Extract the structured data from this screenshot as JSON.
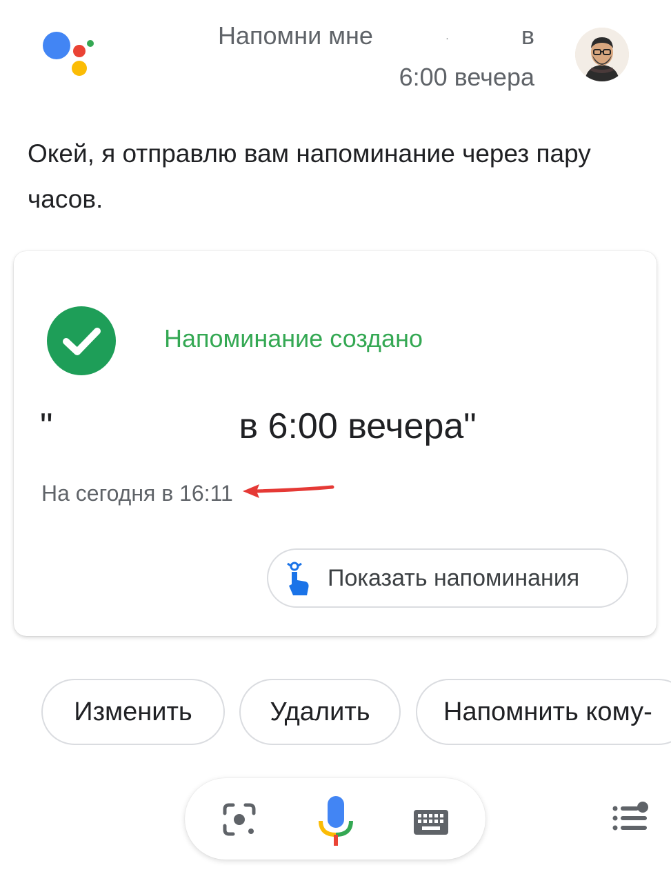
{
  "query": {
    "line1_start": "Напомни мне",
    "line1_dot": ".",
    "line1_end": "в",
    "line2": "6:00 вечера"
  },
  "reply": {
    "text": "Окей, я отправлю вам напоминание через пару часов."
  },
  "card": {
    "status": "Напоминание создано",
    "quote_open": "\"",
    "quote_text": "в 6:00 вечера\"",
    "when": "На сегодня в 16:11",
    "show_reminders_label": "Показать напоминания"
  },
  "suggestions": {
    "edit_label": "Изменить",
    "delete_label": "Удалить",
    "remind_someone_label": "Напомнить кому-"
  },
  "colors": {
    "assistant_blue": "#4285f4",
    "assistant_red": "#ea4335",
    "assistant_yellow": "#fbbc05",
    "assistant_green": "#34a853",
    "check_green": "#1e9e58",
    "annotation_arrow": "#e53935"
  },
  "icons": {
    "logo": "google-assistant-logo",
    "avatar": "user-avatar",
    "check": "check-circle-icon",
    "reminder": "reminder-finger-icon",
    "lens": "lens-icon",
    "mic": "microphone-icon",
    "keyboard": "keyboard-icon",
    "menu": "explore-menu-icon"
  }
}
